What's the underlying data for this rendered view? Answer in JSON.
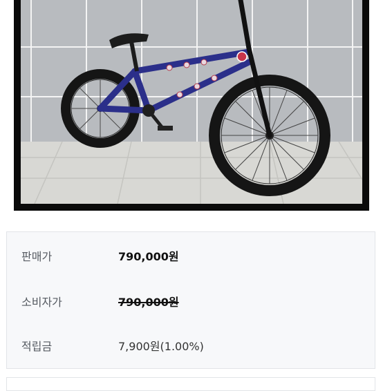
{
  "product_image": {
    "subject": "bmx-bicycle-photo",
    "colors": {
      "frame": "#2b2f8a",
      "tires": "#161616",
      "wall": "#b9bcc0",
      "floor": "#d6d6d2",
      "border": "#0a0a0a"
    }
  },
  "pricing": {
    "rows": [
      {
        "label": "판매가",
        "value": "790,000원"
      },
      {
        "label": "소비자가",
        "value": "790,000원"
      },
      {
        "label": "적립금",
        "value": "7,900원(1.00%)"
      }
    ]
  }
}
